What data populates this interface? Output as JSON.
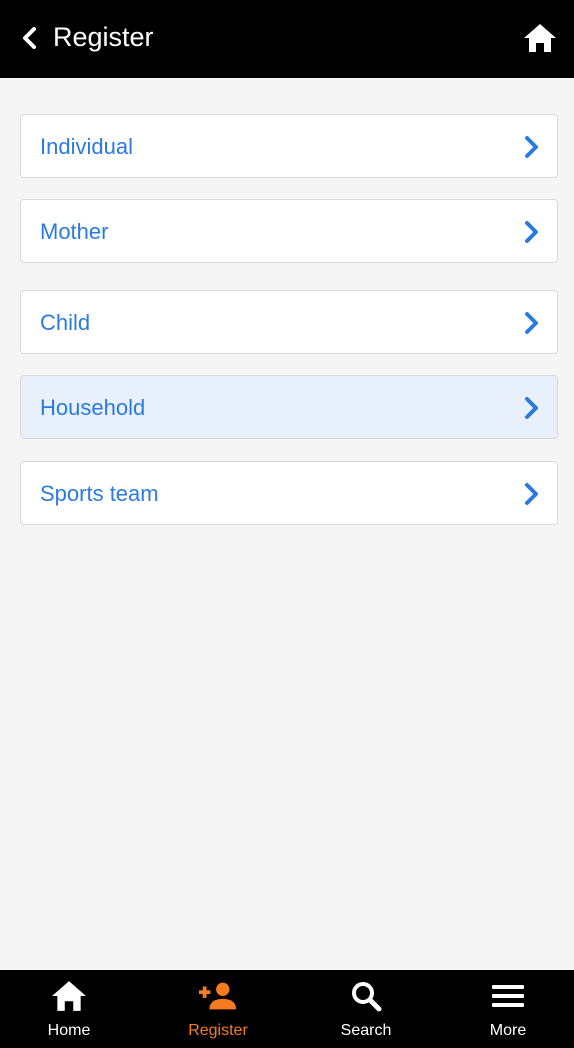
{
  "header": {
    "title": "Register",
    "back_icon": "chevron-left-icon",
    "home_icon": "home-icon"
  },
  "list": {
    "items": [
      {
        "label": "Individual",
        "selected": false
      },
      {
        "label": "Mother",
        "selected": false
      },
      {
        "label": "Child",
        "selected": false
      },
      {
        "label": "Household",
        "selected": true
      },
      {
        "label": "Sports team",
        "selected": false
      }
    ]
  },
  "bottom_nav": {
    "tabs": [
      {
        "label": "Home",
        "icon": "home-icon",
        "active": false
      },
      {
        "label": "Register",
        "icon": "add-person-icon",
        "active": true
      },
      {
        "label": "Search",
        "icon": "search-icon",
        "active": false
      },
      {
        "label": "More",
        "icon": "menu-icon",
        "active": false
      }
    ]
  },
  "colors": {
    "header_bg": "#000000",
    "link_blue": "#2b7ae0",
    "active_orange": "#f47b20",
    "selected_bg": "#e8f0fb",
    "page_bg": "#f5f5f5"
  }
}
